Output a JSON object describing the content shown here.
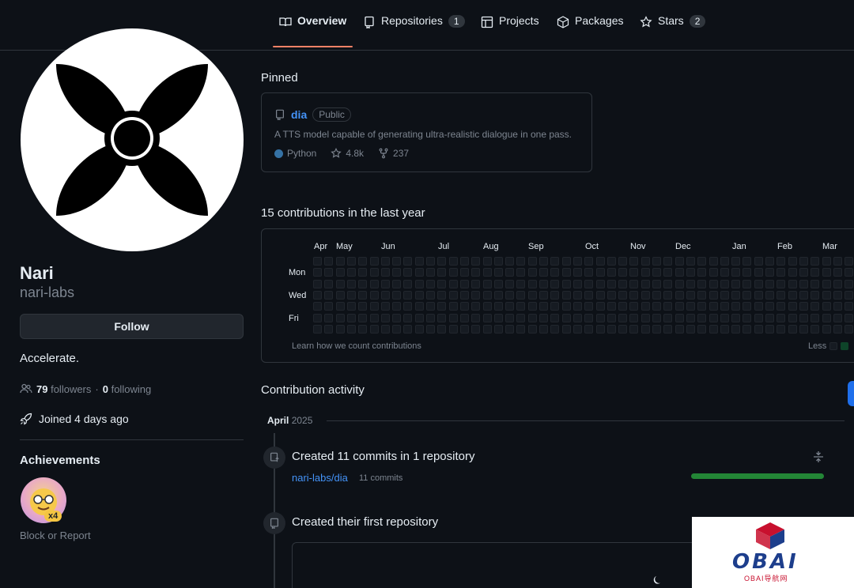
{
  "nav": {
    "tabs": [
      {
        "label": "Overview",
        "icon": "book-icon",
        "active": true
      },
      {
        "label": "Repositories",
        "icon": "repo-icon",
        "count": "1"
      },
      {
        "label": "Projects",
        "icon": "table-icon"
      },
      {
        "label": "Packages",
        "icon": "package-icon"
      },
      {
        "label": "Stars",
        "icon": "star-icon",
        "count": "2"
      }
    ]
  },
  "profile": {
    "name": "Nari",
    "login": "nari-labs",
    "follow_label": "Follow",
    "bio": "Accelerate.",
    "followers_count": "79",
    "followers_label": "followers",
    "separator": "·",
    "following_count": "0",
    "following_label": "following",
    "joined": "Joined 4 days ago",
    "achievements_title": "Achievements",
    "achievement_multiplier": "x4",
    "block_label": "Block or Report"
  },
  "pinned": {
    "title": "Pinned",
    "repo_name": "dia",
    "visibility": "Public",
    "description": "A TTS model capable of generating ultra-realistic dialogue in one pass.",
    "language": "Python",
    "stars": "4.8k",
    "forks": "237",
    "language_color": "#3572a5"
  },
  "contributions": {
    "title": "15 contributions in the last year",
    "months": [
      "Apr",
      "May",
      "Jun",
      "Jul",
      "Aug",
      "Sep",
      "Oct",
      "Nov",
      "Dec",
      "Jan",
      "Feb",
      "Mar"
    ],
    "days": [
      "Mon",
      "Wed",
      "Fri"
    ],
    "learn_link": "Learn how we count contributions",
    "legend_less": "Less"
  },
  "activity": {
    "title": "Contribution activity",
    "month": "April",
    "year": "2025",
    "item1_text": "Created 11 commits in 1 repository",
    "item1_repo": "nari-labs/dia",
    "item1_count": "11 commits",
    "item2_text": "Created their first repository"
  },
  "watermark": {
    "brand": "OBAI",
    "subtitle": "OBAI导航网"
  },
  "colors": {
    "background": "#0d1117",
    "accent_tab": "#f78166",
    "link": "#4493f8",
    "graph_green": "#238636"
  }
}
